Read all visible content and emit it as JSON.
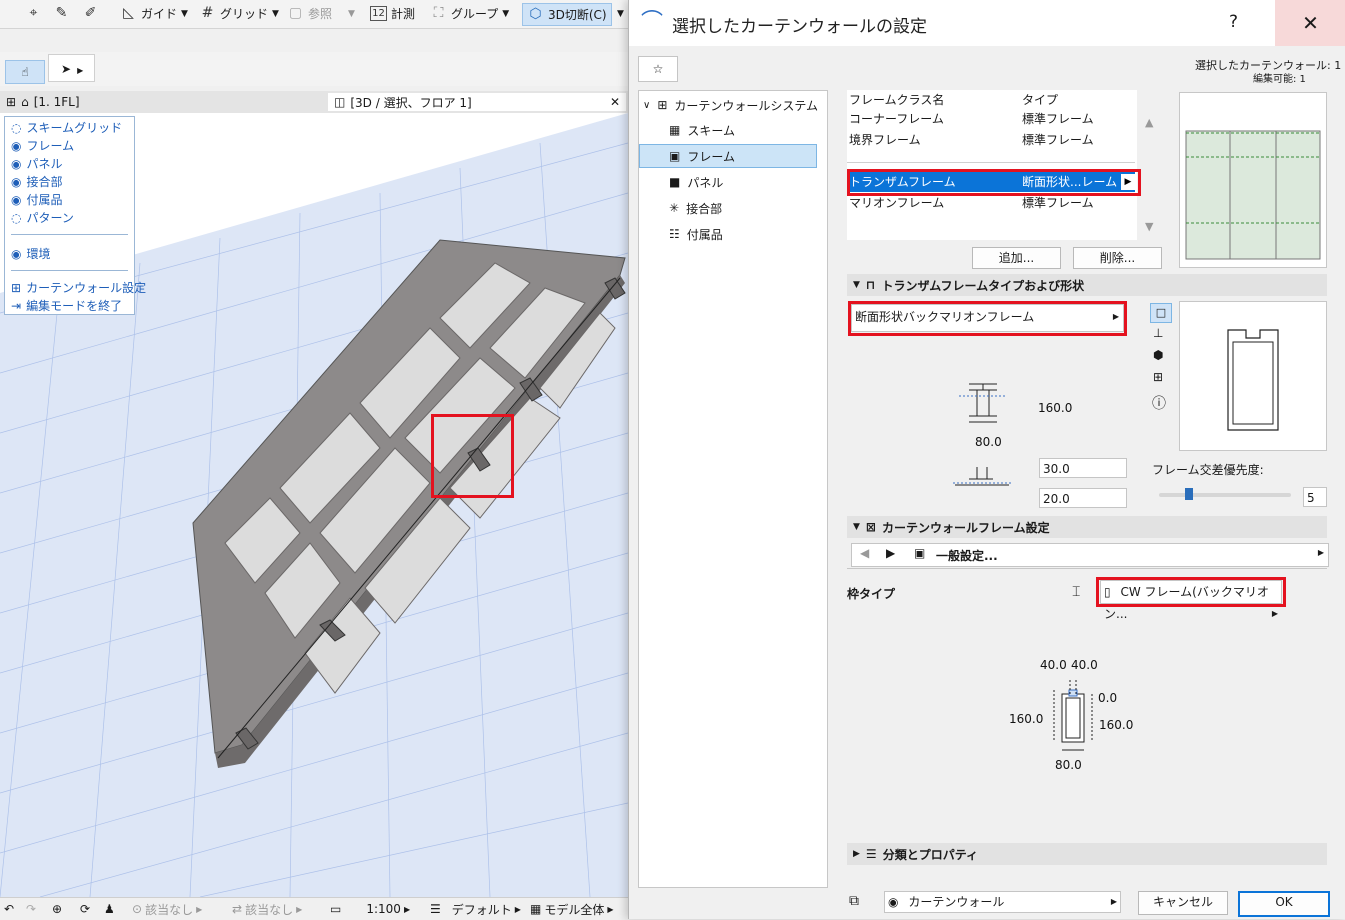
{
  "toolbar": {
    "guide": "ガイド",
    "grid": "グリッド",
    "reference": "参照",
    "measure": "計測",
    "group": "グループ",
    "cut3d": "3D切断(C)"
  },
  "tabs": {
    "floor_tab": "[1. 1FL]",
    "view3d_tab": "[3D / 選択、フロア 1]"
  },
  "palette": {
    "items": [
      "スキームグリッド",
      "フレーム",
      "パネル",
      "接合部",
      "付属品",
      "パターン"
    ],
    "environment": "環境",
    "cw_settings": "カーテンウォール設定",
    "exit_edit": "編集モードを終了"
  },
  "statusbar": {
    "none1": "該当なし",
    "none2": "該当なし",
    "scale": "1:100",
    "default": "デフォルト",
    "model": "モデル全体"
  },
  "dialog": {
    "title": "選択したカーテンウォールの設定",
    "help": "?",
    "close": "✕",
    "selected_info": "選択したカーテンウォール: 1",
    "editable_info": "編集可能: 1",
    "tree": {
      "root": "カーテンウォールシステム",
      "items": [
        "スキーム",
        "フレーム",
        "パネル",
        "接合部",
        "付属品"
      ]
    },
    "frame_list": {
      "header_name": "フレームクラス名",
      "header_type": "タイプ",
      "rows": [
        {
          "name": "コーナーフレーム",
          "type": "標準フレーム"
        },
        {
          "name": "境界フレーム",
          "type": "標準フレーム"
        },
        {
          "name": "トランザムフレーム",
          "type": "断面形状...レーム"
        },
        {
          "name": "マリオンフレーム",
          "type": "標準フレーム"
        }
      ],
      "add_button": "追加...",
      "delete_button": "削除..."
    },
    "transom_section": {
      "title": "トランザムフレームタイプおよび形状",
      "profile_select": "断面形状バックマリオンフレーム",
      "depth_value": "160.0",
      "width_value": "80.0",
      "offset1": "30.0",
      "offset2": "20.0",
      "priority_label": "フレーム交差優先度:",
      "priority_value": "5"
    },
    "frame_settings": {
      "title": "カーテンウォールフレーム設定",
      "general_settings": "一般設定...",
      "frame_type_label": "枠タイプ",
      "frame_type_value": "CW フレーム(バックマリオン...",
      "dim_top_left": "40.0",
      "dim_top_right": "40.0",
      "dim_zero": "0.0",
      "dim_left": "160.0",
      "dim_right": "160.0",
      "dim_bottom": "80.0"
    },
    "classification": {
      "title": "分類とプロパティ"
    },
    "footer": {
      "layer": "カーテンウォール",
      "cancel": "キャンセル",
      "ok": "OK"
    }
  }
}
